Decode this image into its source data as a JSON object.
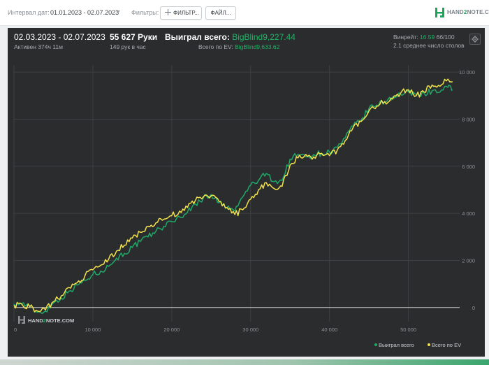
{
  "toolbar": {
    "interval_label": "Интервал дат:",
    "interval_value": "01.01.2023 - 02.07.2023",
    "filters_label": "Фильтры:",
    "filter_button": "ФИЛЬТР...",
    "files_button": "ФАЙЛ...",
    "brand_prefix": "HAND",
    "brand_two": "2",
    "brand_suffix": "NOTE.COM"
  },
  "summary": {
    "date_range": "02.03.2023 - 02.07.2023",
    "active": "Активен 374ч 11м",
    "hands": "55 627 Руки",
    "hands_per_hour": "149 рук в час",
    "won_label": "Выиграл всего:",
    "won_value": "BigBlind9,227.44",
    "ev_label": "Всего по EV:",
    "ev_value": "BigBlind9,633.62",
    "winrate_label": "Винрейт:",
    "winrate_value": "16.59",
    "winrate_suffix": "66/100",
    "tables": "2.1 среднее число столов"
  },
  "watermark": {
    "prefix": "HAND",
    "two": "2",
    "suffix": "NOTE.COM"
  },
  "colors": {
    "won_series": "#1fa968",
    "ev_series": "#f2e24a",
    "panel_bg": "#2b2c2e",
    "accent_green": "#1fb366"
  },
  "chart_data": {
    "type": "line",
    "title": "",
    "xlabel": "",
    "ylabel": "",
    "xlim": [
      0,
      56500
    ],
    "ylim": [
      -600,
      10300
    ],
    "x_ticks": [
      "0",
      "10 000",
      "20 000",
      "30 000",
      "40 000",
      "50 000"
    ],
    "y_ticks": [
      "0",
      "2 000",
      "4 000",
      "6 000",
      "8 000",
      "10 000"
    ],
    "grid": true,
    "legend_position": "bottom-right",
    "series": [
      {
        "name": "Выиграл всего",
        "x": [
          0,
          1000,
          2000,
          3000,
          4000,
          5000,
          6000,
          7000,
          8000,
          9000,
          10000,
          11000,
          12000,
          13000,
          14000,
          15000,
          16000,
          17000,
          18000,
          19000,
          20000,
          21000,
          22000,
          23000,
          24000,
          25000,
          26000,
          27000,
          28000,
          29000,
          30000,
          31000,
          32000,
          33000,
          34000,
          35000,
          36000,
          37000,
          38000,
          39000,
          40000,
          41000,
          42000,
          43000,
          44000,
          45000,
          46000,
          47000,
          48000,
          49000,
          50000,
          51000,
          52000,
          53000,
          54000,
          55000,
          55600
        ],
        "y": [
          150,
          180,
          40,
          -200,
          -150,
          200,
          400,
          700,
          950,
          1150,
          1400,
          1550,
          1750,
          2100,
          2300,
          2550,
          2800,
          3000,
          3250,
          3450,
          3650,
          3850,
          4050,
          4400,
          4650,
          4800,
          4450,
          4250,
          4100,
          4700,
          5200,
          5400,
          5700,
          5350,
          5400,
          6300,
          6500,
          6400,
          6500,
          6550,
          6600,
          6800,
          7200,
          7700,
          7950,
          8450,
          8600,
          8750,
          8950,
          9050,
          9150,
          9050,
          9100,
          9200,
          9150,
          9350,
          9250
        ]
      },
      {
        "name": "Всего по EV",
        "x": [
          0,
          1000,
          2000,
          3000,
          4000,
          5000,
          6000,
          7000,
          8000,
          9000,
          10000,
          11000,
          12000,
          13000,
          14000,
          15000,
          16000,
          17000,
          18000,
          19000,
          20000,
          21000,
          22000,
          23000,
          24000,
          25000,
          26000,
          27000,
          28000,
          29000,
          30000,
          31000,
          32000,
          33000,
          34000,
          35000,
          36000,
          37000,
          38000,
          39000,
          40000,
          41000,
          42000,
          43000,
          44000,
          45000,
          46000,
          47000,
          48000,
          49000,
          50000,
          51000,
          52000,
          53000,
          54000,
          55000,
          55600
        ],
        "y": [
          100,
          140,
          30,
          -150,
          -100,
          250,
          500,
          850,
          1050,
          1350,
          1600,
          1800,
          2050,
          2400,
          2650,
          2950,
          3200,
          3450,
          3600,
          3750,
          3900,
          4100,
          4250,
          4550,
          4700,
          4750,
          4500,
          4250,
          3950,
          4150,
          4600,
          5000,
          5300,
          5050,
          5150,
          6050,
          6350,
          6500,
          6400,
          6550,
          6450,
          6700,
          7100,
          7650,
          7900,
          8350,
          8550,
          8750,
          8850,
          9100,
          9250,
          9000,
          9150,
          9450,
          9400,
          9700,
          9600
        ]
      }
    ]
  }
}
